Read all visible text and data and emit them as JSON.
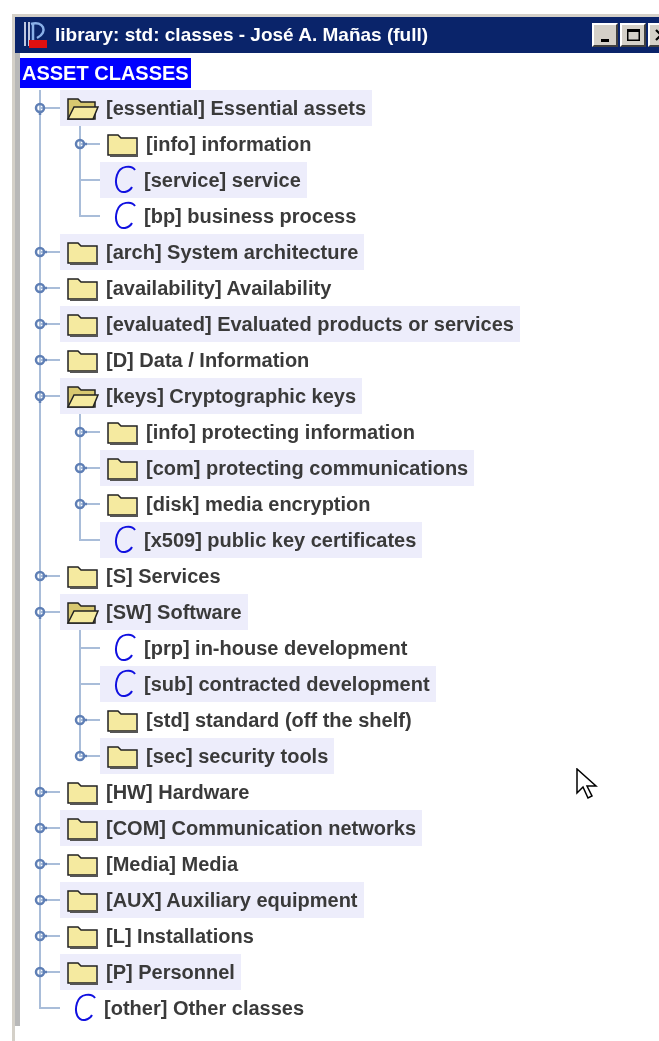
{
  "window": {
    "title": "library: std: classes - José A. Mañas (full)",
    "controls": [
      {
        "kind": "minimize"
      },
      {
        "kind": "maximize"
      },
      {
        "kind": "close"
      }
    ]
  },
  "root": {
    "label": "ASSET CLASSES",
    "selected": true
  },
  "items": [
    {
      "kind": "folder",
      "label": "[essential] Essential assets",
      "expanded": true,
      "children": [
        {
          "kind": "folder",
          "label": "[info] information",
          "expanded": false
        },
        {
          "kind": "class",
          "label": "[service] service"
        },
        {
          "kind": "class",
          "label": "[bp] business process"
        }
      ]
    },
    {
      "kind": "folder",
      "label": "[arch] System architecture",
      "expanded": false
    },
    {
      "kind": "folder",
      "label": "[availability] Availability",
      "expanded": false
    },
    {
      "kind": "folder",
      "label": "[evaluated] Evaluated products or services",
      "expanded": false
    },
    {
      "kind": "folder",
      "label": "[D] Data / Information",
      "expanded": false
    },
    {
      "kind": "folder",
      "label": "[keys] Cryptographic keys",
      "expanded": true,
      "children": [
        {
          "kind": "folder",
          "label": "[info] protecting information",
          "expanded": false
        },
        {
          "kind": "folder",
          "label": "[com] protecting communications",
          "expanded": false
        },
        {
          "kind": "folder",
          "label": "[disk] media encryption",
          "expanded": false
        },
        {
          "kind": "class",
          "label": "[x509] public key certificates"
        }
      ]
    },
    {
      "kind": "folder",
      "label": "[S] Services",
      "expanded": false
    },
    {
      "kind": "folder",
      "label": "[SW] Software",
      "expanded": true,
      "children": [
        {
          "kind": "class",
          "label": "[prp] in-house development"
        },
        {
          "kind": "class",
          "label": "[sub] contracted development"
        },
        {
          "kind": "folder",
          "label": "[std] standard (off the shelf)",
          "expanded": false
        },
        {
          "kind": "folder",
          "label": "[sec] security tools",
          "expanded": false
        }
      ]
    },
    {
      "kind": "folder",
      "label": "[HW] Hardware",
      "expanded": false
    },
    {
      "kind": "folder",
      "label": "[COM] Communication networks",
      "expanded": false
    },
    {
      "kind": "folder",
      "label": "[Media] Media",
      "expanded": false
    },
    {
      "kind": "folder",
      "label": "[AUX] Auxiliary equipment",
      "expanded": false
    },
    {
      "kind": "folder",
      "label": "[L] Installations",
      "expanded": false
    },
    {
      "kind": "folder",
      "label": "[P] Personnel",
      "expanded": false
    },
    {
      "kind": "class",
      "label": "[other] Other classes"
    }
  ]
}
